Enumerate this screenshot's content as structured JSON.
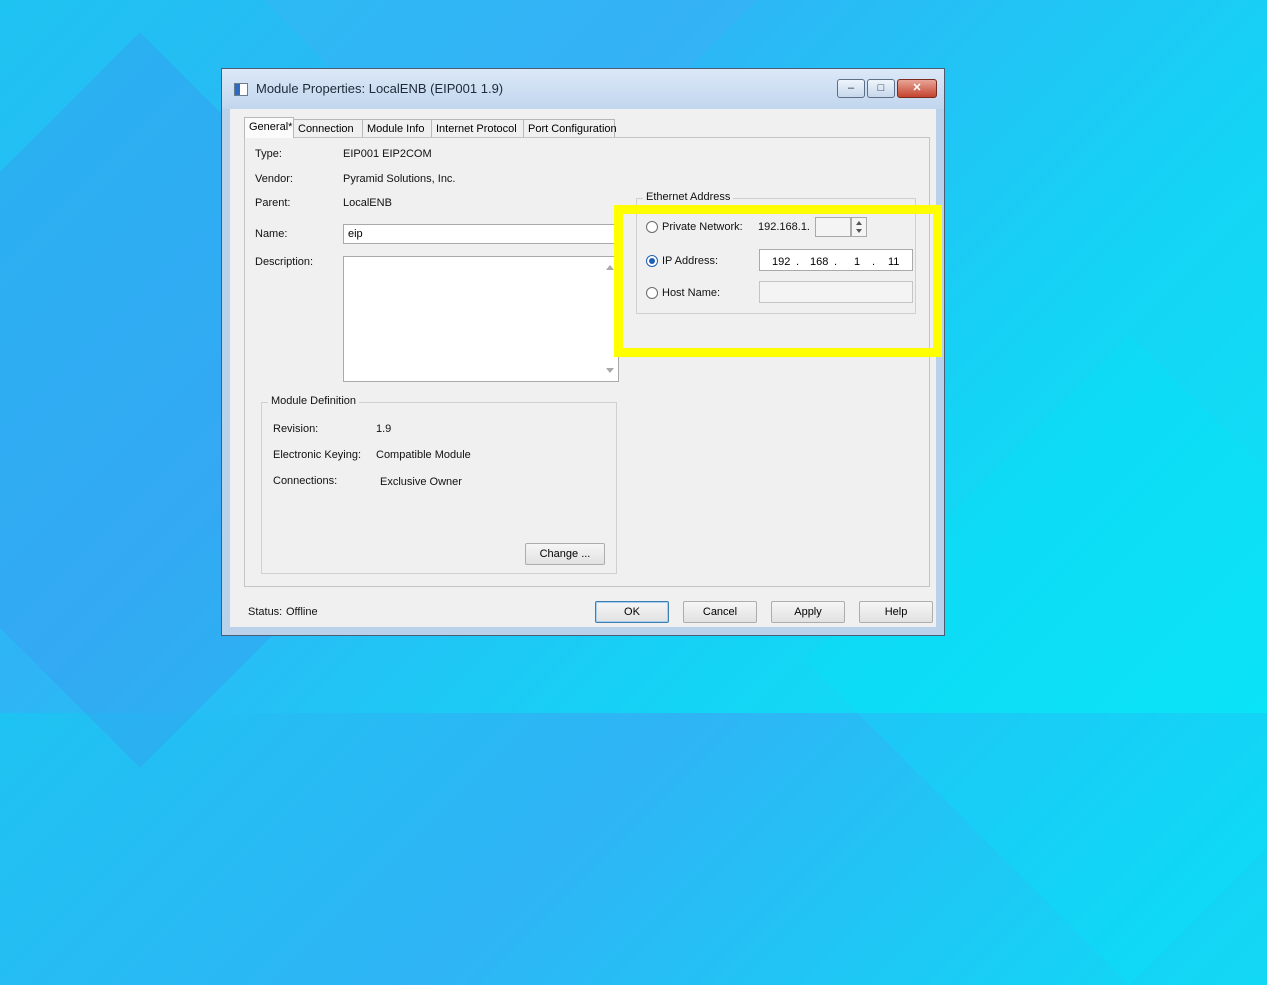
{
  "window": {
    "title": "Module Properties: LocalENB (EIP001 1.9)",
    "minimize": "‒",
    "maximize": "□",
    "close": "✕"
  },
  "tabs": [
    "General*",
    "Connection",
    "Module Info",
    "Internet Protocol",
    "Port Configuration"
  ],
  "general": {
    "type_label": "Type:",
    "type_value": "EIP001 EIP2COM",
    "vendor_label": "Vendor:",
    "vendor_value": "Pyramid Solutions, Inc.",
    "parent_label": "Parent:",
    "parent_value": "LocalENB",
    "name_label": "Name:",
    "name_value": "eip",
    "description_label": "Description:",
    "description_value": ""
  },
  "module_definition": {
    "title": "Module Definition",
    "revision_label": "Revision:",
    "revision_value": "1.9",
    "keying_label": "Electronic Keying:",
    "keying_value": "Compatible Module",
    "connections_label": "Connections:",
    "connections_value": "Exclusive Owner",
    "change_button": "Change ..."
  },
  "ethernet": {
    "title": "Ethernet Address",
    "private_label": "Private Network:",
    "private_prefix": "192.168.1.",
    "private_value": "",
    "ip_label": "IP Address:",
    "ip_octets": [
      "192",
      "168",
      "1",
      "11"
    ],
    "host_label": "Host Name:",
    "host_value": "",
    "selected": "IP Address"
  },
  "footer": {
    "status_label": "Status:",
    "status_value": "Offline",
    "ok": "OK",
    "cancel": "Cancel",
    "apply": "Apply",
    "help": "Help"
  },
  "colors": {
    "highlight": "#ffff00",
    "background": "#1ec3f2"
  }
}
